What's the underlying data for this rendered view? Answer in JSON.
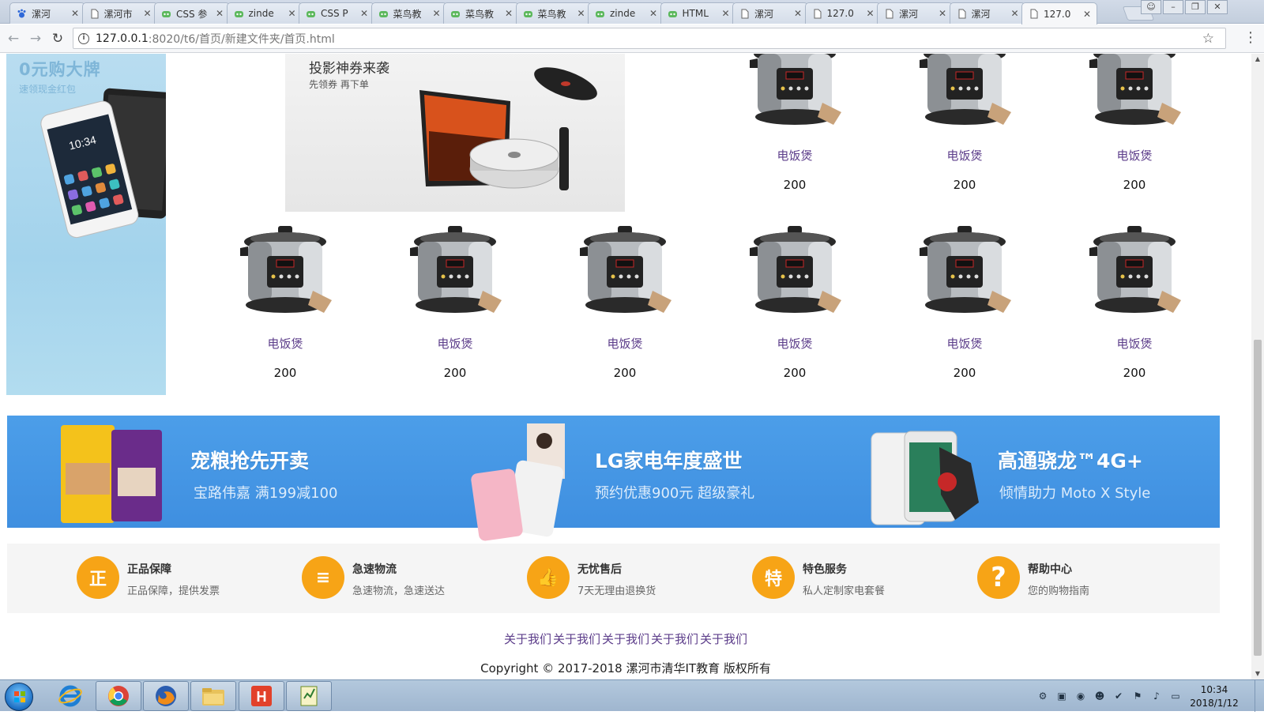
{
  "browser": {
    "tabs": [
      {
        "title": "漯河",
        "icon": "baidu-paw-icon"
      },
      {
        "title": "漯河市",
        "icon": "page-icon"
      },
      {
        "title": "CSS 参",
        "icon": "runoob-icon"
      },
      {
        "title": "zinde",
        "icon": "runoob-icon"
      },
      {
        "title": "CSS P",
        "icon": "runoob-icon"
      },
      {
        "title": "菜鸟教",
        "icon": "runoob-icon"
      },
      {
        "title": "菜鸟教",
        "icon": "runoob-icon"
      },
      {
        "title": "菜鸟教",
        "icon": "runoob-icon"
      },
      {
        "title": "zinde",
        "icon": "runoob-icon"
      },
      {
        "title": "HTML",
        "icon": "runoob-icon"
      },
      {
        "title": "漯河",
        "icon": "page-icon"
      },
      {
        "title": "127.0",
        "icon": "page-icon"
      },
      {
        "title": "漯河",
        "icon": "page-icon"
      },
      {
        "title": "漯河",
        "icon": "page-icon"
      },
      {
        "title": "127.0",
        "icon": "page-icon",
        "active": true
      }
    ],
    "url_host": "127.0.0.1",
    "url_path": ":8020/t6/首页/新建文件夹/首页.html"
  },
  "promo_left": {
    "title": "0元购大牌",
    "subtitle": "速领现金红包"
  },
  "promo_projector": {
    "title": "投影神券来袭",
    "subtitle": "先领券 再下单"
  },
  "products": [
    {
      "name": "电饭煲",
      "price": "200"
    },
    {
      "name": "电饭煲",
      "price": "200"
    },
    {
      "name": "电饭煲",
      "price": "200"
    },
    {
      "name": "电饭煲",
      "price": "200"
    },
    {
      "name": "电饭煲",
      "price": "200"
    },
    {
      "name": "电饭煲",
      "price": "200"
    },
    {
      "name": "电饭煲",
      "price": "200"
    },
    {
      "name": "电饭煲",
      "price": "200"
    },
    {
      "name": "电饭煲",
      "price": "200"
    }
  ],
  "ads": [
    {
      "title": "宠粮抢先开卖",
      "subtitle": "宝路伟嘉   满199减100"
    },
    {
      "title": "LG家电年度盛世",
      "subtitle": "预约优惠900元   超级豪礼"
    },
    {
      "title": "高通骁龙™4G+",
      "subtitle": "倾情助力   Moto X Style"
    }
  ],
  "services": [
    {
      "title": "正品保障",
      "desc": "正品保障，提供发票",
      "icon": "shield-icon",
      "glyph": "正"
    },
    {
      "title": "急速物流",
      "desc": "急速物流，急速送达",
      "icon": "delivery-icon",
      "glyph": "≡"
    },
    {
      "title": "无忧售后",
      "desc": "7天无理由退换货",
      "icon": "thumbs-up-icon",
      "glyph": "👍"
    },
    {
      "title": "特色服务",
      "desc": "私人定制家电套餐",
      "icon": "special-icon",
      "glyph": "特"
    },
    {
      "title": "帮助中心",
      "desc": "您的购物指南",
      "icon": "help-icon",
      "glyph": "?"
    }
  ],
  "footer": {
    "links": [
      "关于我们",
      "关于我们",
      "关于我们",
      "关于我们",
      "关于我们"
    ],
    "copyright": "Copyright © 2017-2018 漯河市清华IT教育 版权所有"
  },
  "taskbar": {
    "time": "10:34",
    "date": "2018/1/12"
  },
  "colors": {
    "accent_blue": "#4c9ee9",
    "service_orange": "#f7a416",
    "link_purple": "#5c3d8a"
  }
}
